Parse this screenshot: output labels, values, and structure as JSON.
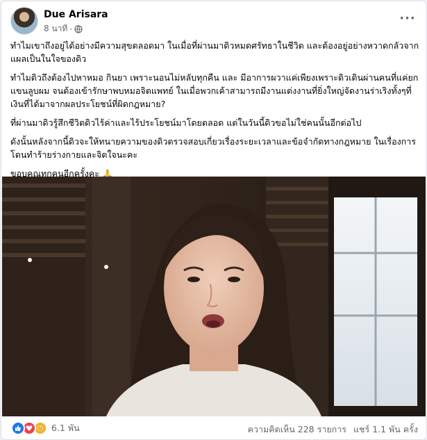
{
  "post": {
    "author": "Due Arisara",
    "timestamp": "8 นาที",
    "separator": "·",
    "privacy_icon": "globe-icon",
    "more_icon": "ellipsis-icon",
    "paragraphs": [
      "ทำไมเขาถึงอยู่ได้อย่างมีความสุขตลอดมา ในเมื่อที่ผ่านมาดิวหมดศรัทธาในชีวิต และต้องอยู่อย่างหวาดกลัวจากแผลเป็นในใจของดิว",
      "ทำไมดิวถึงต้องไปหาหมอ กินยา เพราะนอนไม่หลับทุกคืน และ มีอาการผวาแค่เพียงเพราะดิวเดินผ่านคนที่แค่ยกแขนลูบผม จนต้องเข้ารักษาพบหมอจิตแพทย์ ในเมื่อพวกเค้าสามารถมีงานแต่งงานที่ยิ่งใหญ่จัดงานร่าเริงทั้งๆที่เงินที่ได้มาจากผลประโยชน์ที่ผิดกฎหมาย?",
      "ที่ผ่านมาดิวรู้สึกชีวิตดิวไร้ค่าและไร้ประโยชน์มาโดยตลอด แต่ในวันนี้ดิวขอไม่ใช่คนนั้นอีกต่อไป",
      "ดังนั้นหลังจากนี้ดิวจะให้ทนายความของดิวตรวจสอบเกี่ยวเรื่องระยะเวลาและข้อจำกัดทางกฎหมาย ในเรื่องการโดนทำร้ายร่างกายและจิตใจนะคะ",
      "ขอบคุณทุกคนอีกครั้งคะ 🙏"
    ]
  },
  "footer": {
    "reaction_icons": [
      "like-icon",
      "love-icon",
      "care-icon"
    ],
    "reaction_count": "6.1 พัน",
    "comments": "ความคิดเห็น 228 รายการ",
    "shares": "แชร์ 1.1 พัน ครั้ง"
  },
  "colors": {
    "secondary_text": "#65676b",
    "like_blue": "#1877f2",
    "love_red": "#f33e58",
    "care_yellow": "#f7b125"
  }
}
